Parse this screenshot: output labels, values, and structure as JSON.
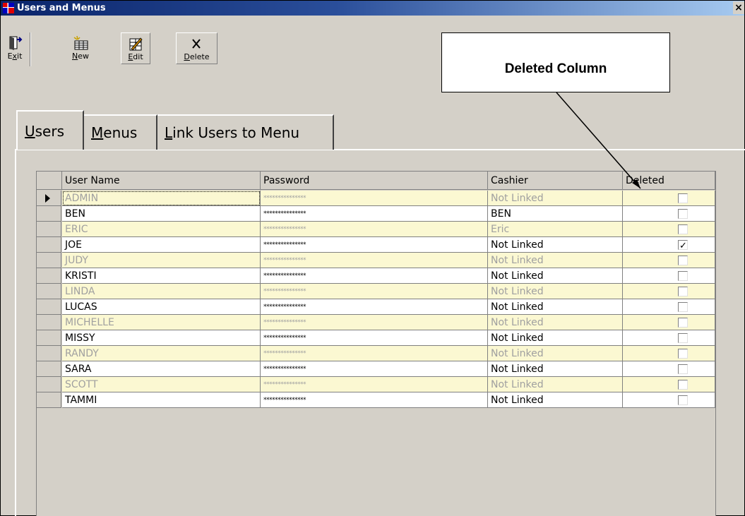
{
  "window": {
    "title": "Users and Menus",
    "close_glyph": "×"
  },
  "toolbar": {
    "exit": {
      "pre": "E",
      "ul": "x",
      "post": "it",
      "icon": "exit-door-icon"
    },
    "new": {
      "pre": "",
      "ul": "N",
      "post": "ew",
      "icon": "new-record-icon"
    },
    "edit": {
      "pre": "",
      "ul": "E",
      "post": "dit",
      "icon": "edit-record-icon"
    },
    "delete": {
      "pre": "",
      "ul": "D",
      "post": "elete",
      "icon": "delete-x-icon"
    }
  },
  "callout": {
    "text": "Deleted Column"
  },
  "tabs": [
    {
      "ul": "U",
      "rest": "sers"
    },
    {
      "ul": "M",
      "rest": "enus"
    },
    {
      "ul": "L",
      "rest": "ink Users to Menu"
    }
  ],
  "grid": {
    "columns": [
      "User Name",
      "Password",
      "Cashier",
      "Deleted"
    ],
    "rows": [
      {
        "user": "ADMIN",
        "password": "***************",
        "cashier": "Not Linked",
        "deleted": false
      },
      {
        "user": "BEN",
        "password": "***************",
        "cashier": "BEN",
        "deleted": false
      },
      {
        "user": "ERIC",
        "password": "***************",
        "cashier": "Eric",
        "deleted": false
      },
      {
        "user": "JOE",
        "password": "***************",
        "cashier": "Not Linked",
        "deleted": true
      },
      {
        "user": "JUDY",
        "password": "***************",
        "cashier": "Not Linked",
        "deleted": false
      },
      {
        "user": "KRISTI",
        "password": "***************",
        "cashier": "Not Linked",
        "deleted": false
      },
      {
        "user": "LINDA",
        "password": "***************",
        "cashier": "Not Linked",
        "deleted": false
      },
      {
        "user": "LUCAS",
        "password": "***************",
        "cashier": "Not Linked",
        "deleted": false
      },
      {
        "user": "MICHELLE",
        "password": "***************",
        "cashier": "Not Linked",
        "deleted": false
      },
      {
        "user": "MISSY",
        "password": "***************",
        "cashier": "Not Linked",
        "deleted": false
      },
      {
        "user": "RANDY",
        "password": "***************",
        "cashier": "Not Linked",
        "deleted": false
      },
      {
        "user": "SARA",
        "password": "***************",
        "cashier": "Not Linked",
        "deleted": false
      },
      {
        "user": "SCOTT",
        "password": "***************",
        "cashier": "Not Linked",
        "deleted": false
      },
      {
        "user": "TAMMI",
        "password": "***************",
        "cashier": "Not Linked",
        "deleted": false
      }
    ]
  },
  "colors": {
    "title_start": "#0a246a",
    "title_end": "#a6caf0",
    "alt_row": "#fbf8d2",
    "face": "#d4d0c8"
  }
}
